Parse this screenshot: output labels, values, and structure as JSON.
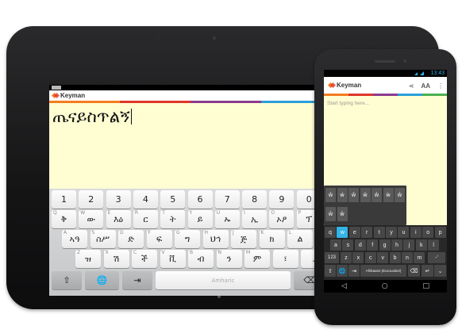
{
  "tablet": {
    "app_name": "Keyman",
    "typed_text": "ጤናይስጥልኝ",
    "keyboard": {
      "row1": [
        {
          "label": "1",
          "hint": "1"
        },
        {
          "label": "2",
          "hint": "2"
        },
        {
          "label": "3",
          "hint": "3"
        },
        {
          "label": "4",
          "hint": "4"
        },
        {
          "label": "5",
          "hint": "5"
        },
        {
          "label": "6",
          "hint": "6"
        },
        {
          "label": "7",
          "hint": "7"
        },
        {
          "label": "8",
          "hint": "8"
        },
        {
          "label": "9",
          "hint": "9"
        },
        {
          "label": "0",
          "hint": "0"
        }
      ],
      "row2": [
        {
          "label": "ቅ",
          "hint": "Q"
        },
        {
          "label": "ው",
          "hint": "W"
        },
        {
          "label": "እዕ",
          "hint": "E"
        },
        {
          "label": "ር",
          "hint": "R"
        },
        {
          "label": "ት",
          "hint": "T"
        },
        {
          "label": "ይ",
          "hint": "Y"
        },
        {
          "label": "ኡ",
          "hint": "U"
        },
        {
          "label": "ኢ",
          "hint": "I"
        },
        {
          "label": "ኦዖ",
          "hint": "O"
        },
        {
          "label": "ፕ",
          "hint": "P"
        }
      ],
      "row3": [
        {
          "label": "ኣዓ",
          "hint": "A"
        },
        {
          "label": "ስሥ",
          "hint": "S"
        },
        {
          "label": "ድ",
          "hint": "D"
        },
        {
          "label": "ፍ",
          "hint": "F"
        },
        {
          "label": "ግ",
          "hint": "G"
        },
        {
          "label": "ህኅ",
          "hint": "H"
        },
        {
          "label": "ጅ",
          "hint": "J"
        },
        {
          "label": "ክ",
          "hint": "K"
        },
        {
          "label": "ል",
          "hint": "L"
        }
      ],
      "row4": [
        {
          "label": "ዝ",
          "hint": "Z"
        },
        {
          "label": "ሽ",
          "hint": "X"
        },
        {
          "label": "ች",
          "hint": "C"
        },
        {
          "label": "ቪ",
          "hint": "V"
        },
        {
          "label": "ብ",
          "hint": "B"
        },
        {
          "label": "ን",
          "hint": "N"
        },
        {
          "label": "ም",
          "hint": "M"
        },
        {
          "label": "፣",
          "hint": ""
        },
        {
          "label": ".",
          "hint": ""
        }
      ],
      "space_label": "Amharic",
      "shift_glyph": "⇧",
      "globe_glyph": "🌐",
      "tab_glyph": "⇥",
      "backspace_glyph": "⌫"
    }
  },
  "phone": {
    "time": "13:43",
    "app_name": "Keyman",
    "share_glyph": "⋖",
    "font_glyph": "AA",
    "menu_glyph": "⋮",
    "placeholder": "Start typing here...",
    "popup_row1": [
      "ŵ",
      "ẃ",
      "ŵ",
      "ẅ",
      "ŵ",
      "ẁ",
      "ŵ"
    ],
    "popup_row2": [
      "ŵ",
      "ŵ"
    ],
    "row1": [
      "q",
      "w",
      "e",
      "r",
      "t",
      "y",
      "u",
      "i",
      "o",
      "p"
    ],
    "row2": [
      "a",
      "s",
      "d",
      "f",
      "g",
      "h",
      "j",
      "k",
      "l"
    ],
    "row3": [
      "z",
      "x",
      "c",
      "v",
      "b",
      "n",
      "m"
    ],
    "row3_left": "123",
    "row3_right": "-'",
    "keyboard_name": "Afrikaans (EuroLatin2)",
    "enter_glyph": "↵",
    "nav": [
      "◁",
      "○",
      "□"
    ]
  },
  "colors": {
    "stripe": [
      "#f47c20",
      "#e0352b",
      "#8b3a8f",
      "#2a9fd8",
      "#4caf50"
    ],
    "phone_accent": "#33b5e5"
  }
}
